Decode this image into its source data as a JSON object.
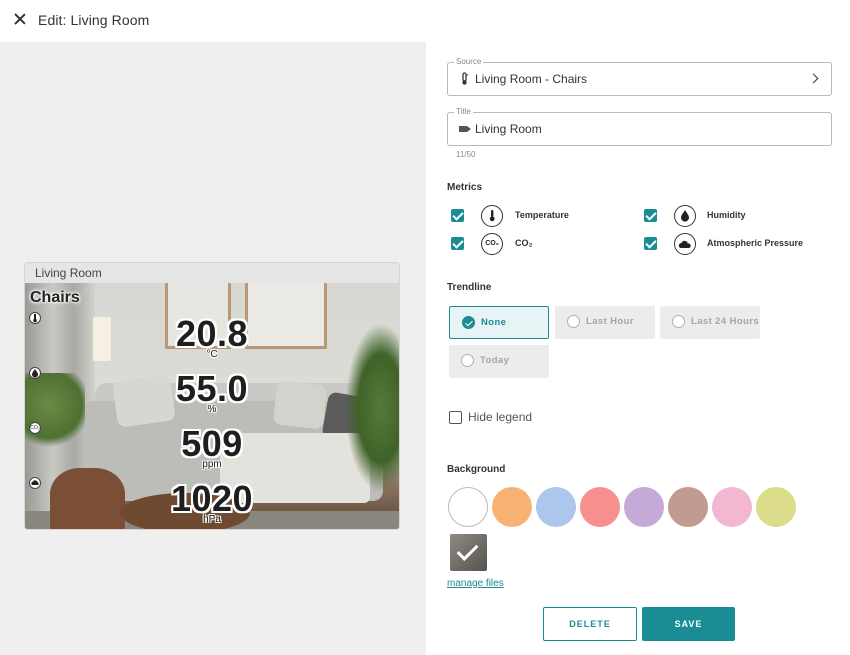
{
  "header": {
    "title": "Edit: Living Room"
  },
  "preview": {
    "widget_title": "Living Room",
    "heading": "Chairs",
    "metrics": [
      {
        "value": "20.8",
        "unit": "°C",
        "icon": "thermometer-icon"
      },
      {
        "value": "55.0",
        "unit": "%",
        "icon": "droplet-icon"
      },
      {
        "value": "509",
        "unit": "ppm",
        "icon": "co2-icon"
      },
      {
        "value": "1020",
        "unit": "hPa",
        "icon": "pressure-cloud-icon"
      }
    ]
  },
  "source": {
    "legend": "Source",
    "value": "Living Room - Chairs",
    "icon": "thermometer-icon"
  },
  "title_field": {
    "legend": "Title",
    "value": "Living Room",
    "icon": "tag-icon",
    "counter": "11/50"
  },
  "metrics": {
    "label": "Metrics",
    "items": [
      {
        "label": "Temperature",
        "checked": true,
        "icon": "thermometer-icon"
      },
      {
        "label": "Humidity",
        "checked": true,
        "icon": "droplet-icon"
      },
      {
        "label": "CO₂",
        "checked": true,
        "icon": "co2-icon",
        "icon_text": "CO₂"
      },
      {
        "label": "Atmospheric Pressure",
        "checked": true,
        "icon": "pressure-cloud-icon"
      }
    ]
  },
  "trendline": {
    "label": "Trendline",
    "options": [
      "None",
      "Last Hour",
      "Last 24 Hours",
      "Today"
    ],
    "selected": "None"
  },
  "hide_legend": {
    "label": "Hide legend",
    "checked": false
  },
  "background": {
    "label": "Background",
    "colors": [
      "#ffffff",
      "#f9b274",
      "#adc6eb",
      "#f78f8f",
      "#c4a9d9",
      "#c19b91",
      "#f3b7d1",
      "#dbdd8a"
    ],
    "image_selected": true,
    "manage_link": "manage files"
  },
  "actions": {
    "delete": "DELETE",
    "save": "SAVE"
  },
  "accent_color": "#1a8c94"
}
